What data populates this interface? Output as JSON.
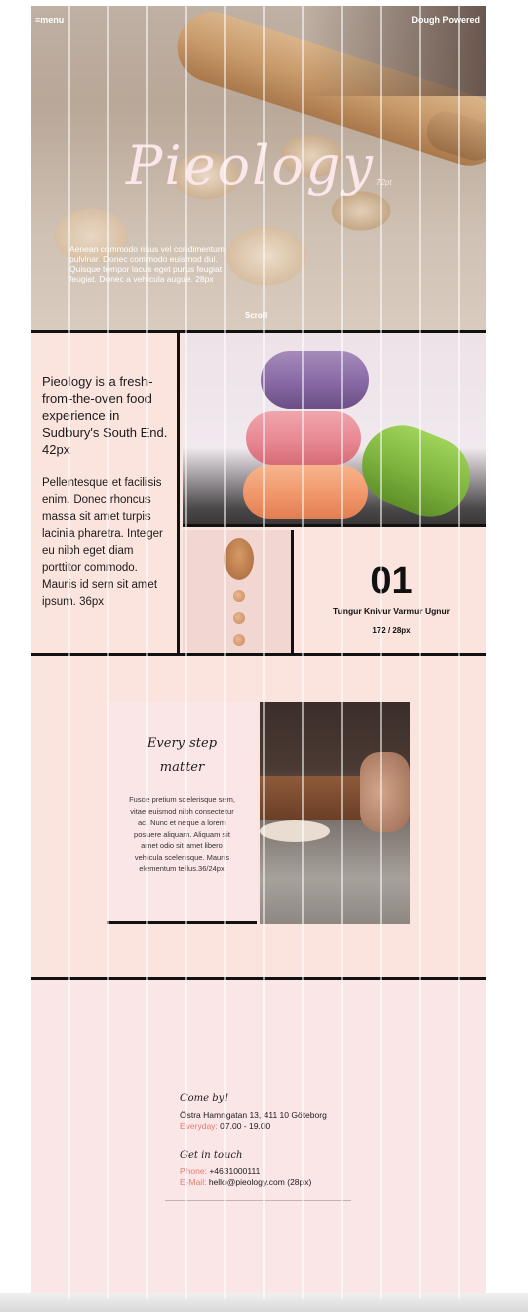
{
  "hero": {
    "menu": "≡menu",
    "brand_tag": "Dough Powered",
    "title": "Pieology",
    "title_size": "72pt",
    "text": "Aenean commodo risus vel condimentum pulvinar. Donec commodo euismod dui. Quisque tempor lacus eget purus feugiat feugiat. Donec a vehicula augue. 28px",
    "scroll": "Scroll"
  },
  "intro": {
    "heading": "Pieology is a fresh-from-the-oven food experience in Sudbury's South End. 42px",
    "body": "Pellentesque et facilisis enim. Donec rhoncus massa sit amet turpis lacinia pharetra. Integer eu nibh eget diam porttitor commodo. Mauris id sem sit amet ipsum. 36px"
  },
  "stat": {
    "number": "01",
    "label": "Tungur Knivur Varmur Ugnur",
    "size": "172 / 28px"
  },
  "feature": {
    "heading_line1": "Every step",
    "heading_line2": "matter",
    "body": "Fusce pretium scelerisque sem, vitae euismod nibh consectetur ac. Nunc et neque a lorem posuere aliquam. Aliquam sit amet odio sit amet libero vehicula scelerisque. Mauris elementum tellus.36/24px"
  },
  "contact": {
    "visit_heading": "Come by!",
    "address": "Östra Hamngatan 13, 411 10 Göteborg",
    "hours_key": "Everyday:",
    "hours_value": "07.00 - 19.00",
    "touch_heading": "Get in touch",
    "phone_key": "Phone:",
    "phone_value": "+4631000111",
    "email_key": "E-Mail:",
    "email_value": "hello@pieology.com",
    "email_size": "(28px)"
  },
  "colors": {
    "accent": "#e7796d",
    "background": "#fbe3de",
    "rule": "#111111"
  }
}
